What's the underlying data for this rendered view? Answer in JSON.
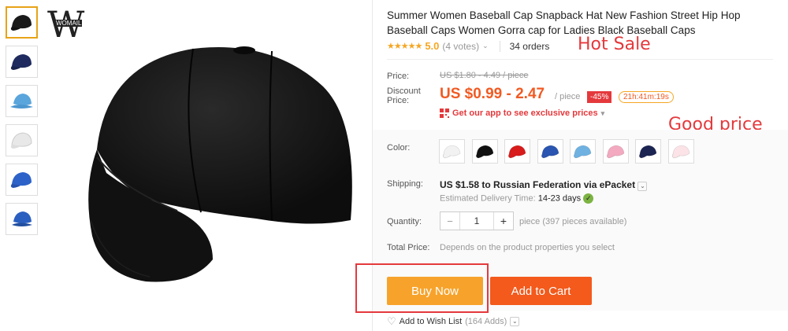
{
  "brand": {
    "logo_letters": "W",
    "logo_text": "WOMAIL"
  },
  "thumbnails": [
    {
      "color": "#1a1a1a",
      "active": true
    },
    {
      "color": "#1f2b5e"
    },
    {
      "color": "#5aa5dc"
    },
    {
      "color": "#e8e8e8"
    },
    {
      "color": "#2d62c9"
    },
    {
      "color": "#2a5fc0"
    }
  ],
  "product": {
    "title": "Summer Women Baseball Cap Snapback Hat New Fashion Street Hip Hop Baseball Caps Women Gorra cap for Ladies Black Baseball Caps",
    "stars": "★★★★★",
    "rating": "5.0",
    "votes": "(4 votes)",
    "orders": "34 orders",
    "overlay_hot": "Hot Sale",
    "overlay_good": "Good price"
  },
  "price": {
    "label": "Price:",
    "original": "US $1.80 - 4.49 / piece",
    "discount_label_1": "Discount",
    "discount_label_2": "Price:",
    "current": "US $0.99 - 2.47",
    "unit": "/ piece",
    "discount_badge": "-45%",
    "timer": "21h:41m:19s",
    "app_promo": "Get our app to see exclusive prices"
  },
  "color": {
    "label": "Color:",
    "swatches": [
      "#f2f2f2",
      "#111111",
      "#d81b1b",
      "#2a55b0",
      "#6fb2e2",
      "#f3a9c0",
      "#1c2452",
      "#fbe3e7"
    ]
  },
  "shipping": {
    "label": "Shipping:",
    "cost": "US $1.58 to Russian Federation via ePacket",
    "estimate_label": "Estimated Delivery Time:",
    "estimate_value": "14-23 days"
  },
  "quantity": {
    "label": "Quantity:",
    "minus": "−",
    "value": "1",
    "plus": "+",
    "available": "piece (397 pieces available)"
  },
  "total": {
    "label": "Total Price:",
    "value": "Depends on the product properties you select"
  },
  "actions": {
    "buy_now": "Buy Now",
    "add_to_cart": "Add to Cart",
    "wishlist": "Add to Wish List",
    "wishlist_count": "(164 Adds)",
    "buy_color": "#f7a32b",
    "cart_color": "#f35a1c"
  }
}
